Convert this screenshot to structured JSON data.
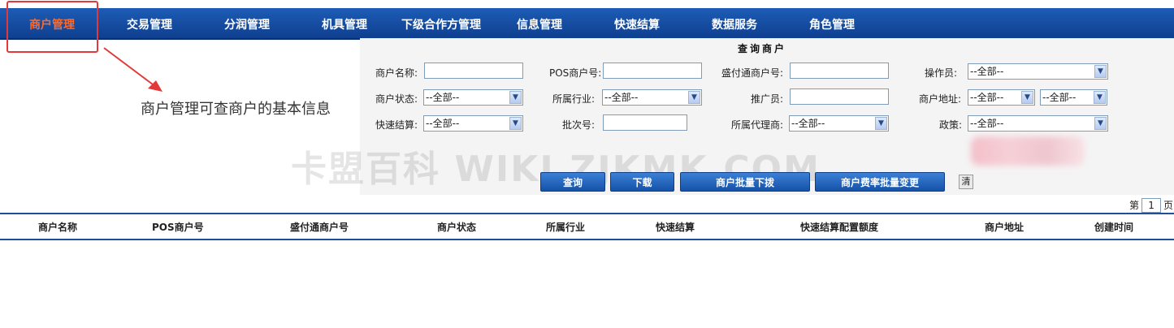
{
  "nav": {
    "items": [
      {
        "label": "商户管理",
        "active": true
      },
      {
        "label": "交易管理"
      },
      {
        "label": "分润管理"
      },
      {
        "label": "机具管理"
      },
      {
        "label": "下级合作方管理"
      },
      {
        "label": "信息管理"
      },
      {
        "label": "快速结算"
      },
      {
        "label": "数据服务"
      },
      {
        "label": "角色管理"
      }
    ]
  },
  "annotation": "商户管理可查商户的基本信息",
  "form": {
    "title": "查询商户",
    "merchant_name_label": "商户名称:",
    "pos_merchant_no_label": "POS商户号:",
    "sft_merchant_no_label": "盛付通商户号:",
    "operator_label": "操作员:",
    "operator_value": "--全部--",
    "merchant_status_label": "商户状态:",
    "merchant_status_value": "--全部--",
    "industry_label": "所属行业:",
    "industry_value": "--全部--",
    "promoter_label": "推广员:",
    "address_label": "商户地址:",
    "address_province_value": "--全部--",
    "address_city_value": "--全部--",
    "quick_settle_label": "快速结算:",
    "quick_settle_value": "--全部--",
    "batch_no_label": "批次号:",
    "agent_label": "所属代理商:",
    "agent_value": "--全部--",
    "policy_label": "政策:",
    "policy_value": "--全部--"
  },
  "buttons": {
    "query": "查询",
    "download": "下载",
    "batch_issue": "商户批量下拨",
    "batch_rate_change": "商户费率批量变更",
    "clear": "清"
  },
  "watermark": "卡盟百科  WIKI.ZJKMK.COM",
  "pager": {
    "prefix": "第",
    "page": "1",
    "suffix": "页"
  },
  "table": {
    "columns": [
      "商户名称",
      "POS商户号",
      "盛付通商户号",
      "商户状态",
      "所属行业",
      "快速结算",
      "快速结算配置额度",
      "商户地址",
      "创建时间"
    ]
  },
  "colors": {
    "nav_bg": "#1d5cb6",
    "active_nav": "#ff6a2a",
    "highlight_box": "#e23a3a",
    "button": "#1552a8"
  }
}
